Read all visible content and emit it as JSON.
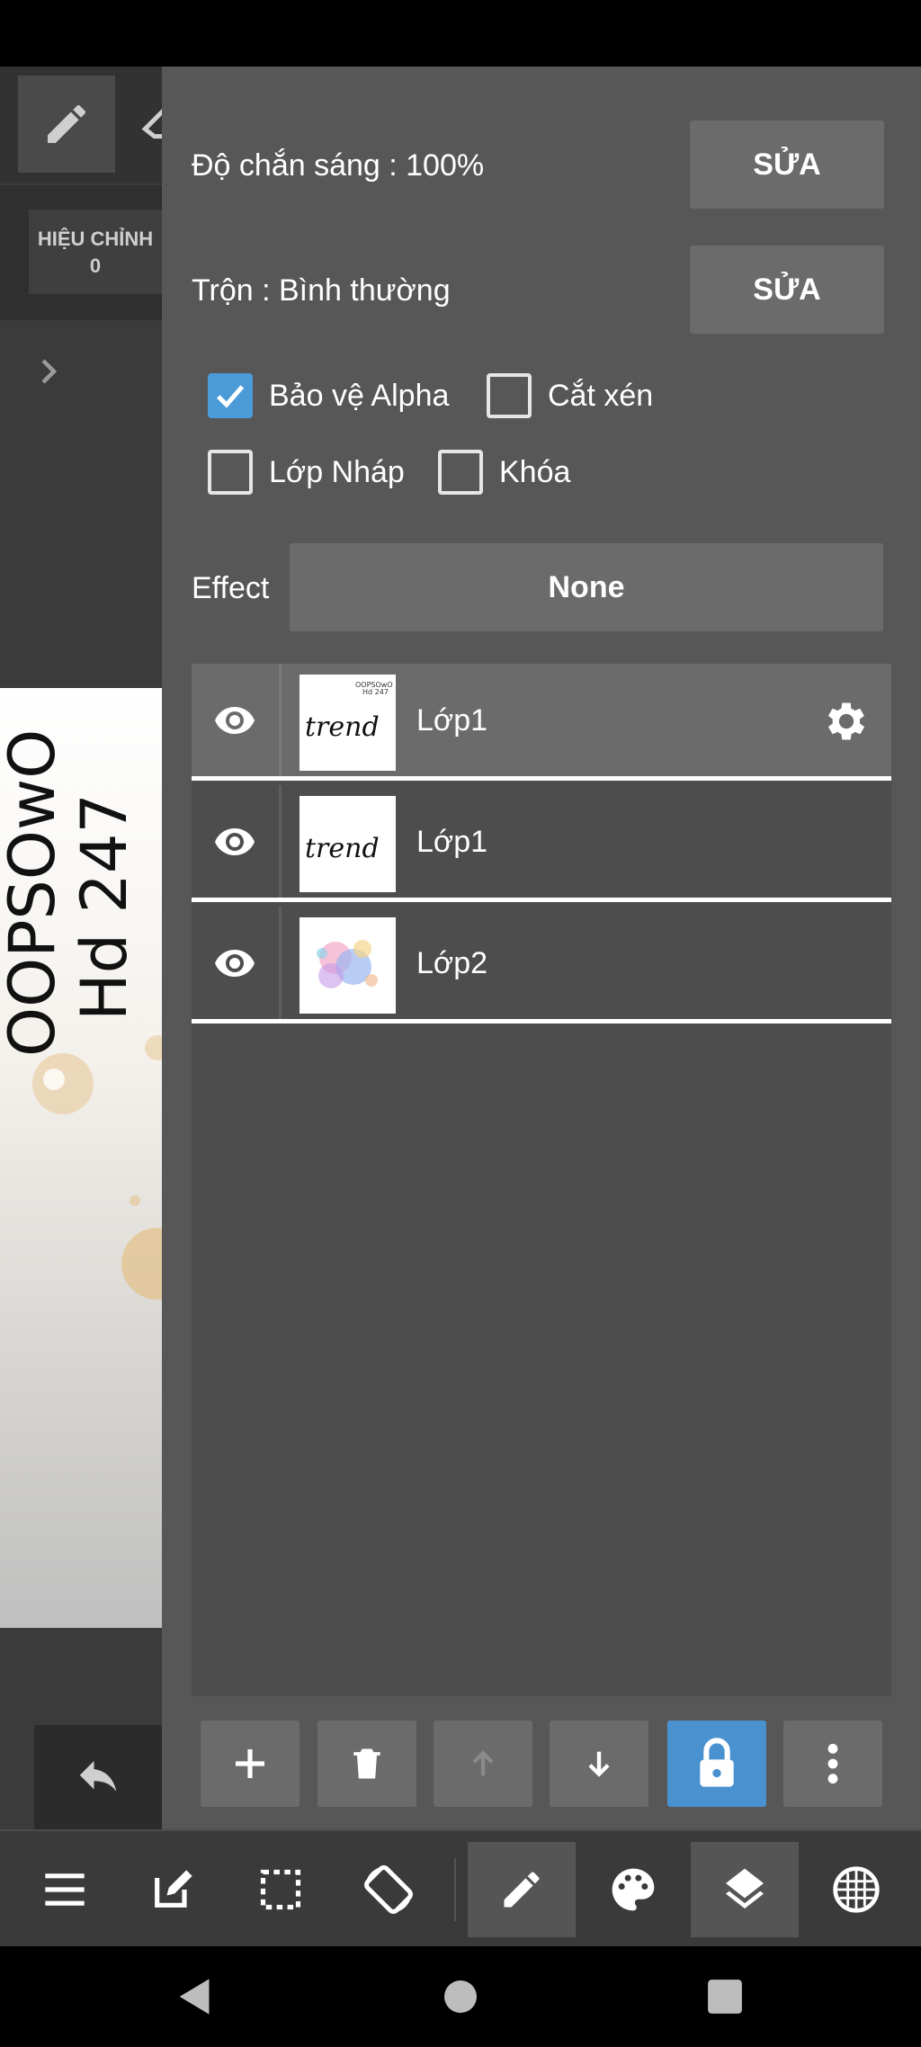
{
  "left_area": {
    "adjust_label": "HIỆU CHỈNH",
    "adjust_value": "0"
  },
  "panel": {
    "opacity_label": "Độ chắn sáng : 100%",
    "opacity_edit": "SỬA",
    "blend_label": "Trộn : Bình thường",
    "blend_edit": "SỬA",
    "checkboxes": [
      {
        "label": "Bảo vệ Alpha",
        "checked": true
      },
      {
        "label": "Cắt xén",
        "checked": false
      },
      {
        "label": "Lớp Nháp",
        "checked": false
      },
      {
        "label": "Khóa",
        "checked": false
      }
    ],
    "effect_label": "Effect",
    "effect_value": "None"
  },
  "layers": [
    {
      "name": "Lớp1",
      "selected": true,
      "visible": true,
      "thumb_text": "trend",
      "thumb_subtext": "OOPSOwO\nHd 247"
    },
    {
      "name": "Lớp1",
      "selected": false,
      "visible": true,
      "thumb_text": "trend"
    },
    {
      "name": "Lớp2",
      "selected": false,
      "visible": true,
      "thumb_text": ""
    }
  ],
  "canvas_preview_text": [
    "OOPSOwO",
    "Hd 247"
  ],
  "layer_actions": [
    "add-icon",
    "trash-icon",
    "move-up-icon",
    "move-down-icon",
    "lock-icon",
    "more-icon"
  ],
  "toolbar_items": [
    "menu-icon",
    "edit-note-icon",
    "selection-icon",
    "rotate-icon",
    "brush-icon",
    "palette-icon",
    "layers-icon",
    "grid-icon"
  ],
  "colors": {
    "accent": "#4a9bd8",
    "panel": "#575757",
    "button": "#6b6b6b"
  }
}
